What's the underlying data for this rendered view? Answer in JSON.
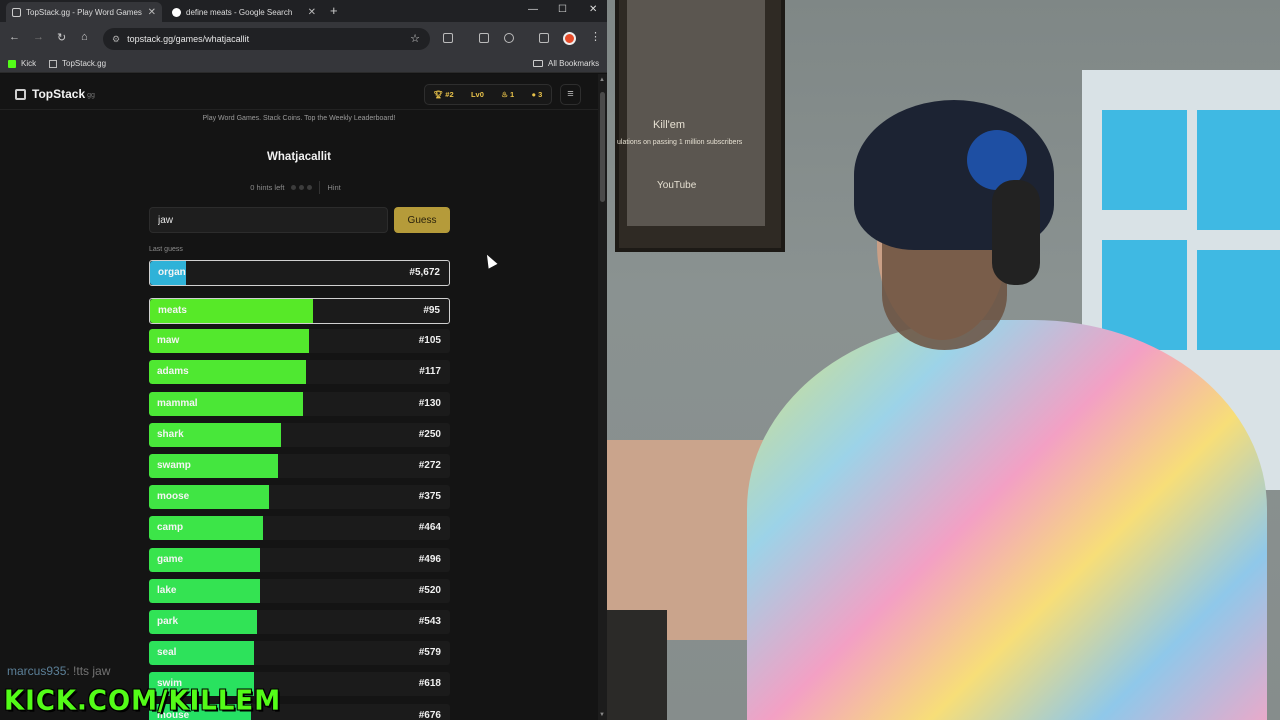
{
  "browser": {
    "tabs": [
      {
        "title": "TopStack.gg - Play Word Games",
        "active": true
      },
      {
        "title": "define meats - Google Search",
        "active": false
      }
    ],
    "url": "topstack.gg/games/whatjacallit",
    "bookmarks": [
      "Kick",
      "TopStack.gg"
    ],
    "all_bookmarks": "All Bookmarks"
  },
  "site": {
    "logo": "TopStack",
    "logo_suffix": "gg",
    "stats": [
      "#2",
      "Lv0",
      "1",
      "3"
    ],
    "tagline": "Play Word Games. Stack Coins. Top the Weekly Leaderboard!"
  },
  "game": {
    "title": "Whatjacallit",
    "hints_left": "0 hints left",
    "hint_button": "Hint",
    "input_value": "jaw",
    "guess_button": "Guess",
    "last_guess_label": "Last guess",
    "last_guess": {
      "word": "organ",
      "rank": "#5,672"
    },
    "guesses": [
      {
        "word": "meats",
        "rank": "#95"
      },
      {
        "word": "maw",
        "rank": "#105"
      },
      {
        "word": "adams",
        "rank": "#117"
      },
      {
        "word": "mammal",
        "rank": "#130"
      },
      {
        "word": "shark",
        "rank": "#250"
      },
      {
        "word": "swamp",
        "rank": "#272"
      },
      {
        "word": "moose",
        "rank": "#375"
      },
      {
        "word": "camp",
        "rank": "#464"
      },
      {
        "word": "game",
        "rank": "#496"
      },
      {
        "word": "lake",
        "rank": "#520"
      },
      {
        "word": "park",
        "rank": "#543"
      },
      {
        "word": "seal",
        "rank": "#579"
      },
      {
        "word": "swim",
        "rank": "#618"
      },
      {
        "word": "mouse",
        "rank": "#676"
      }
    ],
    "bar_fill": [
      0.54,
      0.53,
      0.52,
      0.51,
      0.44,
      0.43,
      0.4,
      0.38,
      0.37,
      0.37,
      0.36,
      0.35,
      0.35,
      0.34
    ],
    "last_fill": 0.12
  },
  "stream": {
    "chat_user": "marcus935",
    "chat_message": ": !tts jaw",
    "kick_brand": "KICK.COM/KILLEM",
    "frame_text_1": "Kill'em",
    "frame_text_2": "ulations on passing 1 million subscribers",
    "frame_text_3": "YouTube"
  },
  "colors": {
    "accent_gold": "#b59b3a",
    "kick_green": "#53fc18",
    "last_guess_blue": "#2fb2d8"
  }
}
